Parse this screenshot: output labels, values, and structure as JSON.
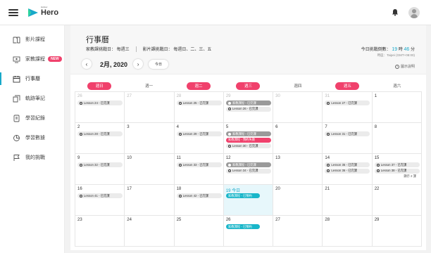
{
  "app": {
    "name": "Hero",
    "name_super": "Hahow"
  },
  "sidebar": {
    "items": [
      {
        "label": "影片課程",
        "icon": "book-icon",
        "active": false
      },
      {
        "label": "家教課程",
        "icon": "tutor-icon",
        "active": false,
        "badge": "NEW"
      },
      {
        "label": "行事曆",
        "icon": "calendar-icon",
        "active": true
      },
      {
        "label": "軌跡筆記",
        "icon": "notes-icon",
        "active": false
      },
      {
        "label": "學習紀錄",
        "icon": "record-icon",
        "active": false
      },
      {
        "label": "學習數據",
        "icon": "chart-icon",
        "active": false
      },
      {
        "label": "我的挑戰",
        "icon": "flag-icon",
        "active": false
      }
    ]
  },
  "header": {
    "title": "行事曆",
    "tutor_challenge": "家教課挑戰日： 每週三",
    "video_challenge": "影片課挑戰日： 每週日、二、三、五",
    "month": "2月, 2020",
    "today_btn": "今日",
    "today_time_label": "今日挑戰倒數：",
    "hours": "19",
    "hours_unit": "時",
    "minutes": "46",
    "minutes_unit": "分",
    "timezone": "時區：Taipei (GMT+08:00)",
    "legend": "圖示說明"
  },
  "calendar": {
    "weekdays": [
      {
        "label": "週日",
        "highlight": true
      },
      {
        "label": "週一",
        "highlight": false
      },
      {
        "label": "週二",
        "highlight": true
      },
      {
        "label": "週三",
        "highlight": true
      },
      {
        "label": "週四",
        "highlight": false
      },
      {
        "label": "週五",
        "highlight": true
      },
      {
        "label": "週六",
        "highlight": false
      }
    ],
    "weeks": [
      [
        {
          "day": "26",
          "dim": true,
          "events": [
            {
              "t": "lesson",
              "text": "Lesson 24 - 已完課"
            }
          ]
        },
        {
          "day": "27",
          "dim": true,
          "events": []
        },
        {
          "day": "28",
          "dim": true,
          "events": [
            {
              "t": "lesson",
              "text": "Lesson 25 - 已完課"
            }
          ]
        },
        {
          "day": "29",
          "dim": true,
          "events": [
            {
              "t": "grey",
              "text": "家教課程 - 已完課"
            },
            {
              "t": "lesson",
              "text": "Lesson 26 - 已完課"
            }
          ]
        },
        {
          "day": "30",
          "dim": true,
          "events": []
        },
        {
          "day": "31",
          "dim": true,
          "events": [
            {
              "t": "lesson",
              "text": "Lesson 27 - 已完課"
            }
          ]
        },
        {
          "day": "1",
          "dim": false,
          "events": []
        }
      ],
      [
        {
          "day": "2",
          "events": [
            {
              "t": "lesson",
              "text": "Lesson 28 - 已完課"
            }
          ]
        },
        {
          "day": "3",
          "events": []
        },
        {
          "day": "4",
          "events": [
            {
              "t": "lesson",
              "text": "Lesson 29 - 已完課"
            }
          ]
        },
        {
          "day": "5",
          "events": [
            {
              "t": "grey",
              "text": "家教課程 - 已完課"
            },
            {
              "t": "red",
              "text": "家教課程 - 預約失敗"
            },
            {
              "t": "lesson",
              "text": "Lesson 30 - 已完課"
            }
          ]
        },
        {
          "day": "6",
          "events": []
        },
        {
          "day": "7",
          "events": [
            {
              "t": "lesson",
              "text": "Lesson 31 - 已完課"
            }
          ]
        },
        {
          "day": "8",
          "events": []
        }
      ],
      [
        {
          "day": "9",
          "events": [
            {
              "t": "lesson",
              "text": "Lesson 32 - 已完課"
            }
          ]
        },
        {
          "day": "10",
          "events": []
        },
        {
          "day": "11",
          "events": [
            {
              "t": "lesson",
              "text": "Lesson 33 - 已完課"
            }
          ]
        },
        {
          "day": "12",
          "events": [
            {
              "t": "grey",
              "text": "家教課程 - 已完課"
            },
            {
              "t": "lesson",
              "text": "Lesson 34 - 已完課"
            }
          ]
        },
        {
          "day": "13",
          "events": []
        },
        {
          "day": "14",
          "events": [
            {
              "t": "lesson",
              "text": "Lesson 35 - 已完課"
            },
            {
              "t": "lesson",
              "text": "Lesson 36 - 已完課"
            }
          ]
        },
        {
          "day": "15",
          "events": [
            {
              "t": "lesson",
              "text": "Lesson 37 - 已完課"
            },
            {
              "t": "lesson",
              "text": "Lesson 38 - 已完課"
            }
          ],
          "more": "顯示 2 課"
        }
      ],
      [
        {
          "day": "16",
          "events": [
            {
              "t": "lesson",
              "text": "Lesson 41 - 已完課"
            }
          ]
        },
        {
          "day": "17",
          "events": []
        },
        {
          "day": "18",
          "events": [
            {
              "t": "lesson",
              "text": "Lesson 42 - 已完課"
            }
          ]
        },
        {
          "day": "19 今日",
          "today": true,
          "events": [
            {
              "t": "teal",
              "text": "家教課程 - 已預約"
            }
          ]
        },
        {
          "day": "20",
          "events": []
        },
        {
          "day": "21",
          "events": []
        },
        {
          "day": "22",
          "events": []
        }
      ],
      [
        {
          "day": "23",
          "events": []
        },
        {
          "day": "24",
          "events": []
        },
        {
          "day": "25",
          "events": []
        },
        {
          "day": "26",
          "events": [
            {
              "t": "teal",
              "text": "家教課程 - 已預約"
            }
          ]
        },
        {
          "day": "27",
          "events": []
        },
        {
          "day": "28",
          "events": []
        },
        {
          "day": "29",
          "events": []
        }
      ]
    ]
  },
  "colors": {
    "accent": "#18a9c9",
    "pink": "#f0416c",
    "grey_event": "#9a9a9a",
    "teal_event": "#19b6c9"
  }
}
